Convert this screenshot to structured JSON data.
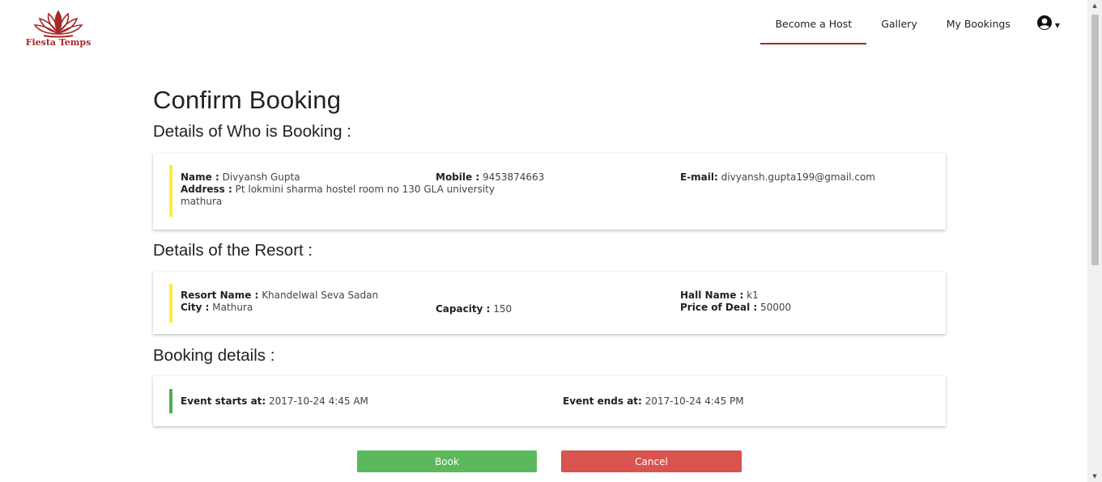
{
  "brand": {
    "name": "Fiesta Temps",
    "accent": "#a52a2a"
  },
  "nav": {
    "items": [
      {
        "label": "Become a Host",
        "active": true
      },
      {
        "label": "Gallery",
        "active": false
      },
      {
        "label": "My Bookings",
        "active": false
      }
    ],
    "user_icon": "user-circle-icon"
  },
  "page": {
    "title": "Confirm Booking"
  },
  "booker": {
    "section_title": "Details of Who is Booking :",
    "name_label": "Name :",
    "name": "Divyansh Gupta",
    "mobile_label": "Mobile :",
    "mobile": "9453874663",
    "email_label": "E-mail:",
    "email": "divyansh.gupta199@gmail.com",
    "address_label": "Address :",
    "address_line1": "Pt lokmini sharma hostel room no 130 GLA university",
    "address_line2": "mathura"
  },
  "resort": {
    "section_title": "Details of the Resort :",
    "resort_name_label": "Resort Name :",
    "resort_name": "Khandelwal Seva Sadan",
    "city_label": "City :",
    "city": "Mathura",
    "capacity_label": "Capacity :",
    "capacity": "150",
    "hall_name_label": "Hall Name :",
    "hall_name": "k1",
    "price_label": "Price of Deal :",
    "price": "50000"
  },
  "booking": {
    "section_title": "Booking details :",
    "start_label": "Event starts at:",
    "start": "2017-10-24 4:45 AM",
    "end_label": "Event ends at:",
    "end": "2017-10-24 4:45 PM"
  },
  "actions": {
    "book_label": "Book",
    "cancel_label": "Cancel"
  },
  "colors": {
    "book": "#5cb85c",
    "cancel": "#d9534f",
    "card_accent_yellow": "#ffeb3b",
    "card_accent_green": "#4caf50"
  }
}
